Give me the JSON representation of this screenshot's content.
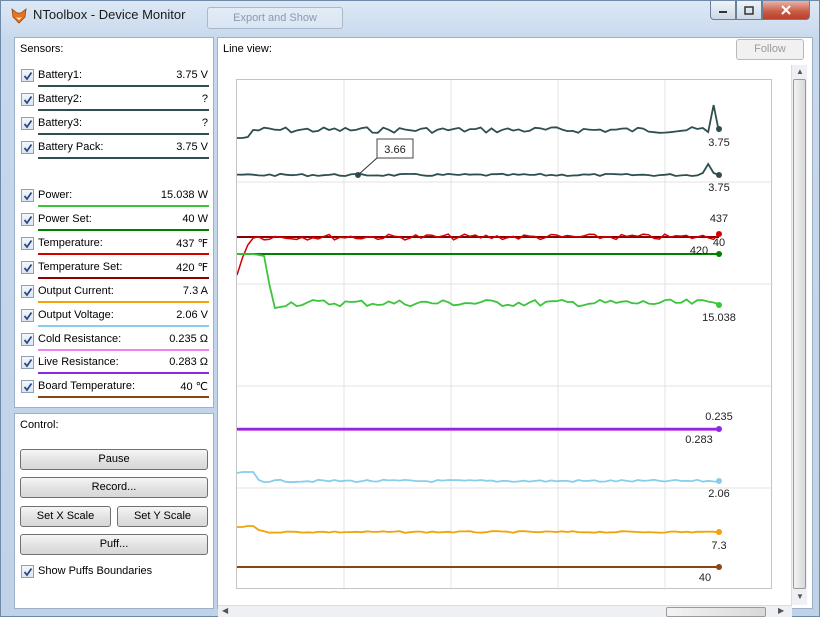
{
  "window": {
    "title": "NToolbox - Device Monitor",
    "background_buttons": [
      "",
      "Export and Show"
    ]
  },
  "sensors": {
    "title": "Sensors:",
    "items": [
      {
        "label": "Battery1:",
        "value": "3.75 V",
        "checked": true,
        "color": "#2f4f4f"
      },
      {
        "label": "Battery2:",
        "value": "?",
        "checked": true,
        "color": "#2f4f4f"
      },
      {
        "label": "Battery3:",
        "value": "?",
        "checked": true,
        "color": "#2f4f4f"
      },
      {
        "label": "Battery Pack:",
        "value": "3.75 V",
        "checked": true,
        "color": "#2f4f4f"
      },
      {
        "label": "Power:",
        "value": "15.038 W",
        "checked": true,
        "color": "#3dc43d"
      },
      {
        "label": "Power Set:",
        "value": "40 W",
        "checked": true,
        "color": "#008000"
      },
      {
        "label": "Temperature:",
        "value": "437 ℉",
        "checked": true,
        "color": "#d40000"
      },
      {
        "label": "Temperature Set:",
        "value": "420 ℉",
        "checked": true,
        "color": "#8b0000"
      },
      {
        "label": "Output Current:",
        "value": "7.3 A",
        "checked": true,
        "color": "#f0a30a"
      },
      {
        "label": "Output Voltage:",
        "value": "2.06 V",
        "checked": true,
        "color": "#87ceeb"
      },
      {
        "label": "Cold Resistance:",
        "value": "0.235 Ω",
        "checked": true,
        "color": "#ee82ee"
      },
      {
        "label": "Live Resistance:",
        "value": "0.283 Ω",
        "checked": true,
        "color": "#8a2be2"
      },
      {
        "label": "Board Temperature:",
        "value": "40 ℃",
        "checked": true,
        "color": "#8b4513"
      }
    ]
  },
  "control": {
    "title": "Control:",
    "pause": "Pause",
    "record": "Record...",
    "set_x_scale": "Set X Scale",
    "set_y_scale": "Set Y Scale",
    "puff": "Puff...",
    "show_puffs_label": "Show Puffs Boundaries",
    "show_puffs_checked": true
  },
  "line_view": {
    "title": "Line view:",
    "follow": "Follow",
    "tooltip": "3.66",
    "end_labels": {
      "battery1": "3.75",
      "battery_pack": "3.75",
      "temperature": "437",
      "power_set": "40",
      "temperature_set": "420",
      "power": "15.038",
      "cold_resistance": "0.235",
      "live_resistance": "0.283",
      "output_voltage": "2.06",
      "output_current": "7.3",
      "board_temperature": "40"
    }
  },
  "colors": {
    "battery": "#2f4f4f",
    "power": "#3dc43d",
    "power_set": "#008000",
    "temperature": "#d40000",
    "temperature_set": "#8b0000",
    "output_current": "#f0a30a",
    "output_voltage": "#87ceeb",
    "resistance": "#8a2be2",
    "board_temperature": "#8b4513"
  }
}
